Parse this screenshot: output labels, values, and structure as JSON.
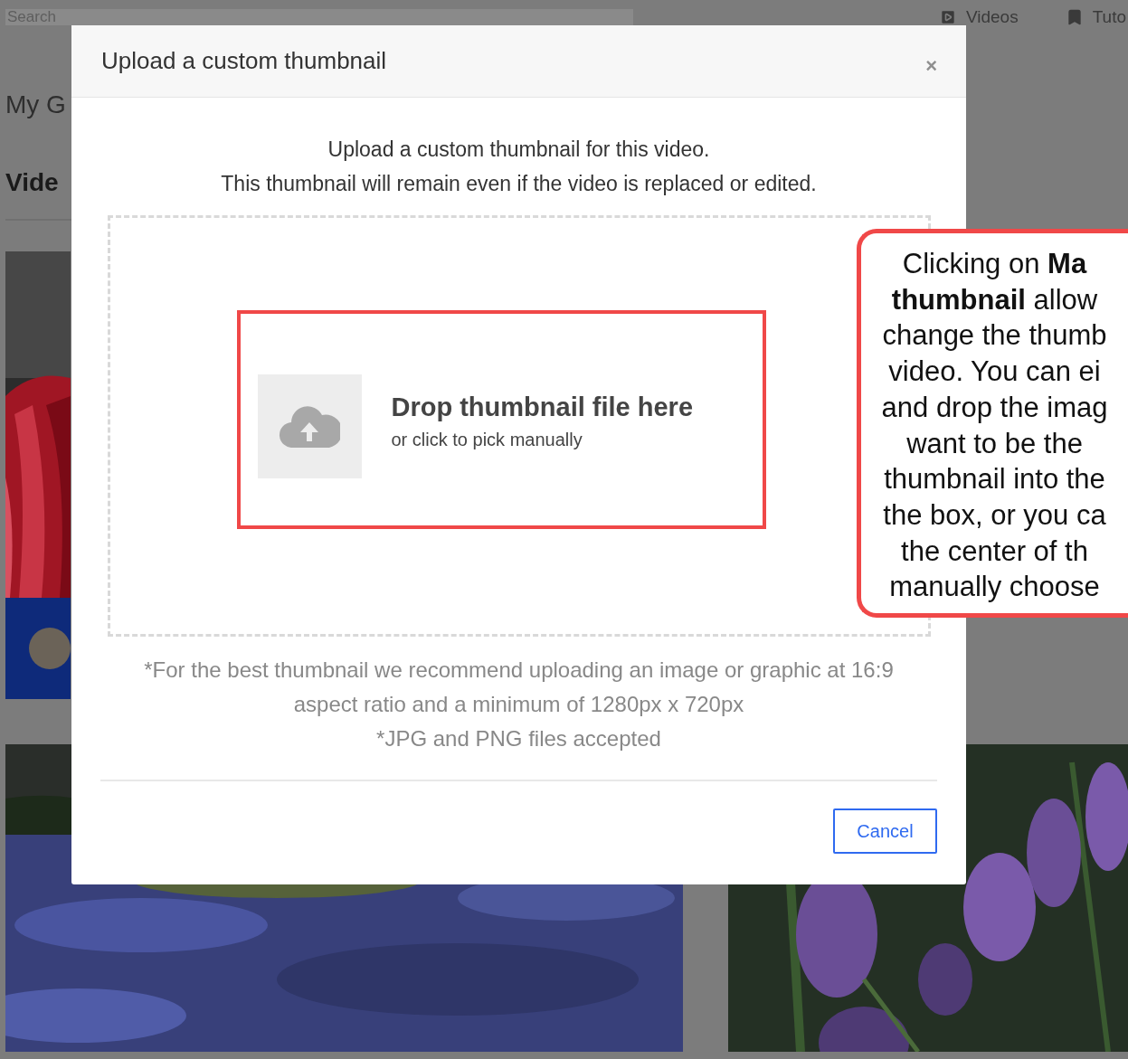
{
  "background": {
    "search": {
      "placeholder": "Search"
    },
    "nav": [
      {
        "label": "Videos"
      },
      {
        "label": "Tuto"
      }
    ],
    "heading": "My G",
    "section": "Vide"
  },
  "dialog": {
    "title": "Upload a custom thumbnail",
    "close": "×",
    "intro": [
      "Upload a custom thumbnail for this video.",
      "This thumbnail will remain even if the video is replaced or edited."
    ],
    "dropzone": {
      "title": "Drop thumbnail file here",
      "subtitle": "or click to pick manually"
    },
    "notes": [
      "*For the best thumbnail we recommend uploading an image or graphic at 16:9 aspect ratio and a minimum of 1280px x 720px",
      "*JPG and PNG files accepted"
    ],
    "buttons": [
      "Cancel"
    ]
  },
  "callout": {
    "lines": [
      "Clicking on **Ma**",
      "**thumbnail** allow",
      "change the thumb",
      "video. You can ei",
      "and drop the imag",
      "want to be the",
      "thumbnail into the",
      "the box, or you ca",
      "the center of th",
      "manually choose"
    ]
  }
}
